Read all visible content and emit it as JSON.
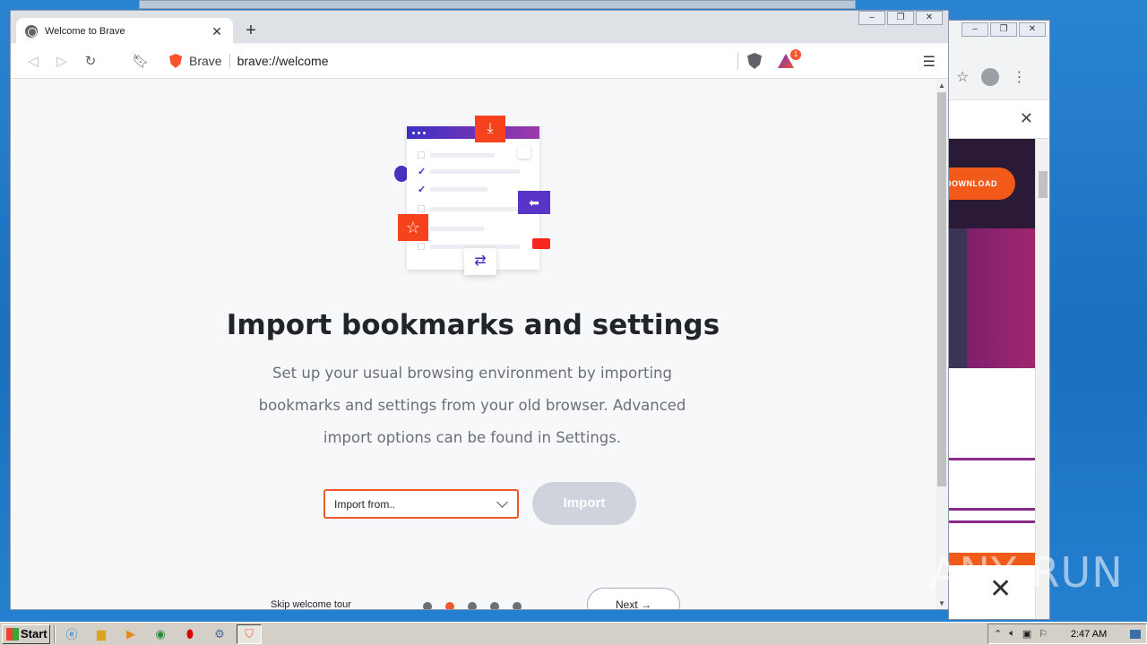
{
  "browser": {
    "tab_title": "Welcome to Brave",
    "tab_close": "✕",
    "new_tab": "+",
    "omnibox_brand": "Brave",
    "url": "brave://welcome",
    "rewards_badge": "1",
    "menu": "☰",
    "window_controls": [
      "–",
      "❐",
      "✕"
    ]
  },
  "welcome": {
    "heading": "Import bookmarks and settings",
    "description": "Set up your usual browsing environment by importing bookmarks and settings from your old browser. Advanced import options can be found in Settings.",
    "import_select_value": "Import from..",
    "import_button": "Import",
    "skip_link": "Skip welcome tour",
    "next_button": "Next →",
    "step_count": 5,
    "active_step": 2
  },
  "background_window": {
    "download_button": "DOWNLOAD",
    "close": "✕",
    "window_controls": [
      "–",
      "❐",
      "✕"
    ]
  },
  "taskbar": {
    "start_label": "Start",
    "clock": "2:47 AM"
  },
  "watermark": "ANY RUN",
  "colors": {
    "brave_orange": "#fb542b",
    "accent_orange": "#f0592b",
    "purple": "#3b2fc7",
    "import_disabled": "#d0d3dc"
  }
}
